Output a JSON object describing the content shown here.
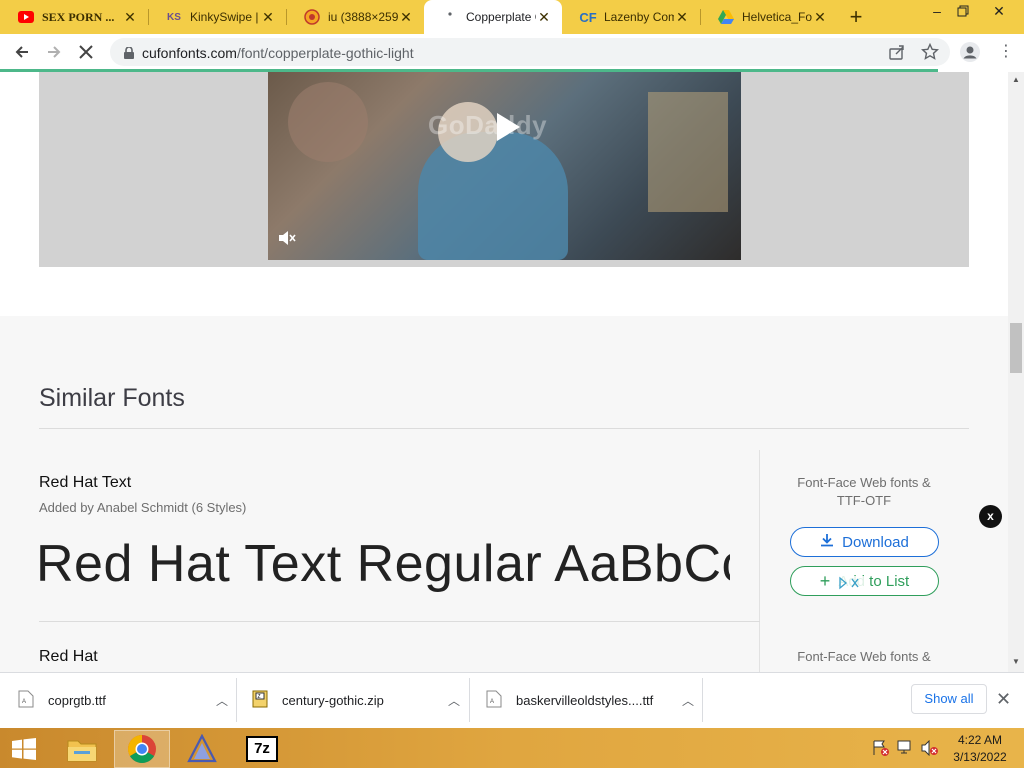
{
  "browser": {
    "tabs": [
      {
        "title": "SEX PORN ...",
        "favicon": "youtube-icon",
        "active": false
      },
      {
        "title": "KinkySwipe | ...",
        "favicon": "KS",
        "active": false
      },
      {
        "title": "iu (3888×259...",
        "favicon": "iu-icon",
        "active": false
      },
      {
        "title": "Copperplate G...",
        "favicon": "dot-icon",
        "active": true
      },
      {
        "title": "Lazenby Com...",
        "favicon": "CF",
        "active": false
      },
      {
        "title": "Helvetica_Fon...",
        "favicon": "drive-icon",
        "active": false
      }
    ],
    "url_host": "cufonfonts.com",
    "url_path": "/font/copperplate-gothic-light"
  },
  "video": {
    "brand": "GoDaddy"
  },
  "similar_fonts": {
    "heading": "Similar Fonts",
    "items": [
      {
        "name": "Red Hat Text",
        "added_by": "Added by Anabel Schmidt (6 Styles)",
        "preview": "Red Hat Text Regular AaBbCc",
        "fontface_line1": "Font-Face Web fonts &",
        "fontface_line2": "TTF-OTF",
        "download_label": "Download",
        "add_list_label": "Add to List"
      },
      {
        "name": "Red Hat",
        "fontface_line1": "Font-Face Web fonts &"
      }
    ]
  },
  "ad": {
    "close_label": "x"
  },
  "downloads": {
    "items": [
      {
        "filename": "coprgtb.ttf"
      },
      {
        "filename": "century-gothic.zip"
      },
      {
        "filename": "baskervilleoldstyles....ttf"
      }
    ],
    "show_all_label": "Show all"
  },
  "taskbar": {
    "time": "4:22 AM",
    "date": "3/13/2022",
    "apps": [
      "file-explorer-icon",
      "chrome-icon",
      "app-icon",
      "7zip-icon"
    ],
    "sevenzip_label": "7z"
  }
}
